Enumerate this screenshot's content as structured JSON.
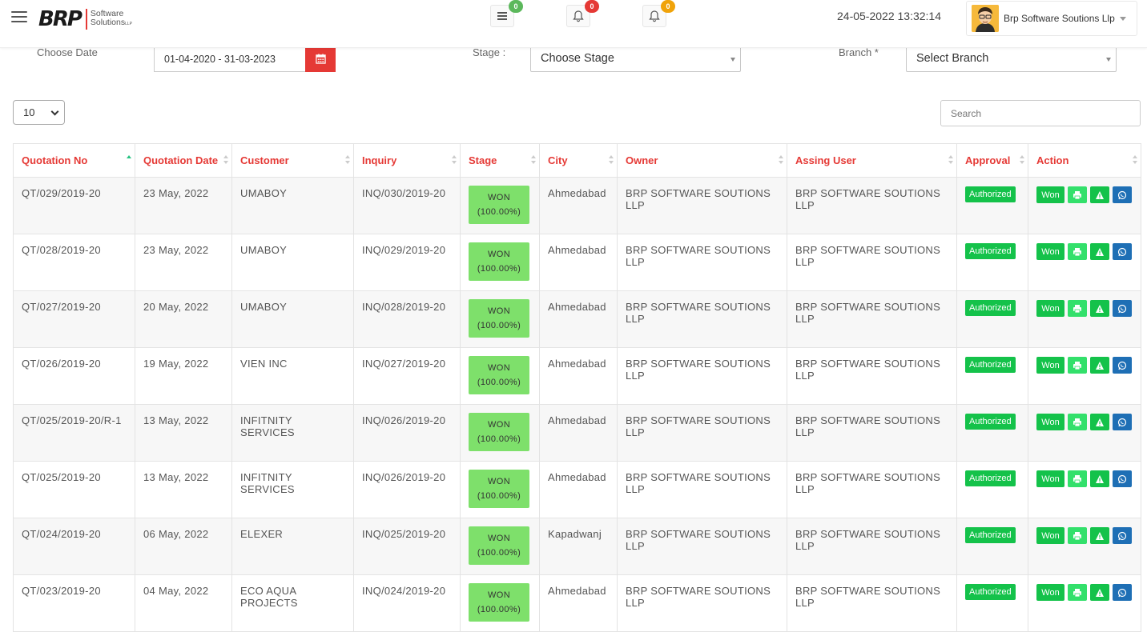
{
  "header": {
    "logo_mark": "BRP",
    "logo_line1": "Software",
    "logo_line2": "Solutions",
    "logo_llp": "LLP",
    "datetime": "24-05-2022 13:32:14",
    "user_name": "Brp Software Soutions Llp",
    "notifications": [
      {
        "name": "list-icon",
        "count": "0",
        "color": "#5cb85c"
      },
      {
        "name": "bell-icon",
        "count": "0",
        "color": "#e53935"
      },
      {
        "name": "bell-icon",
        "count": "0",
        "color": "#f0a30a"
      }
    ]
  },
  "filters": {
    "date_label": "Choose Date",
    "date_value": "01-04-2020 - 31-03-2023",
    "stage_label": "Stage :",
    "stage_value": "Choose Stage",
    "branch_label": "Branch *",
    "branch_value": "Select Branch"
  },
  "table_controls": {
    "page_length": "10",
    "search_placeholder": "Search"
  },
  "table": {
    "columns": [
      "Quotation No",
      "Quotation Date",
      "Customer",
      "Inquiry",
      "Stage",
      "City",
      "Owner",
      "Assing User",
      "Approval",
      "Action"
    ],
    "rows": [
      {
        "no": "QT/029/2019-20",
        "date": "23 May, 2022",
        "customer": "UMABOY",
        "inquiry": "INQ/030/2019-20",
        "stage1": "WON",
        "stage2": "(100.00%)",
        "city": "Ahmedabad",
        "owner": "BRP SOFTWARE SOUTIONS LLP",
        "assign": "BRP SOFTWARE SOUTIONS LLP",
        "approval": "Authorized",
        "action": "Won"
      },
      {
        "no": "QT/028/2019-20",
        "date": "23 May, 2022",
        "customer": "UMABOY",
        "inquiry": "INQ/029/2019-20",
        "stage1": "WON",
        "stage2": "(100.00%)",
        "city": "Ahmedabad",
        "owner": "BRP SOFTWARE SOUTIONS LLP",
        "assign": "BRP SOFTWARE SOUTIONS LLP",
        "approval": "Authorized",
        "action": "Won"
      },
      {
        "no": "QT/027/2019-20",
        "date": "20 May, 2022",
        "customer": "UMABOY",
        "inquiry": "INQ/028/2019-20",
        "stage1": "WON",
        "stage2": "(100.00%)",
        "city": "Ahmedabad",
        "owner": "BRP SOFTWARE SOUTIONS LLP",
        "assign": "BRP SOFTWARE SOUTIONS LLP",
        "approval": "Authorized",
        "action": "Won"
      },
      {
        "no": "QT/026/2019-20",
        "date": "19 May, 2022",
        "customer": "VIEN INC",
        "inquiry": "INQ/027/2019-20",
        "stage1": "WON",
        "stage2": "(100.00%)",
        "city": "Ahmedabad",
        "owner": "BRP SOFTWARE SOUTIONS LLP",
        "assign": "BRP SOFTWARE SOUTIONS LLP",
        "approval": "Authorized",
        "action": "Won"
      },
      {
        "no": "QT/025/2019-20/R-1",
        "date": "13 May, 2022",
        "customer": "INFITNITY SERVICES",
        "inquiry": "INQ/026/2019-20",
        "stage1": "WON",
        "stage2": "(100.00%)",
        "city": "Ahmedabad",
        "owner": "BRP SOFTWARE SOUTIONS LLP",
        "assign": "BRP SOFTWARE SOUTIONS LLP",
        "approval": "Authorized",
        "action": "Won"
      },
      {
        "no": "QT/025/2019-20",
        "date": "13 May, 2022",
        "customer": "INFITNITY SERVICES",
        "inquiry": "INQ/026/2019-20",
        "stage1": "WON",
        "stage2": "(100.00%)",
        "city": "Ahmedabad",
        "owner": "BRP SOFTWARE SOUTIONS LLP",
        "assign": "BRP SOFTWARE SOUTIONS LLP",
        "approval": "Authorized",
        "action": "Won"
      },
      {
        "no": "QT/024/2019-20",
        "date": "06 May, 2022",
        "customer": "ELEXER",
        "inquiry": "INQ/025/2019-20",
        "stage1": "WON",
        "stage2": "(100.00%)",
        "city": "Kapadwanj",
        "owner": "BRP SOFTWARE SOUTIONS LLP",
        "assign": "BRP SOFTWARE SOUTIONS LLP",
        "approval": "Authorized",
        "action": "Won"
      },
      {
        "no": "QT/023/2019-20",
        "date": "04 May, 2022",
        "customer": "ECO AQUA PROJECTS",
        "inquiry": "INQ/024/2019-20",
        "stage1": "WON",
        "stage2": "(100.00%)",
        "city": "Ahmedabad",
        "owner": "BRP SOFTWARE SOUTIONS LLP",
        "assign": "BRP SOFTWARE SOUTIONS LLP",
        "approval": "Authorized",
        "action": "Won"
      }
    ]
  },
  "colors": {
    "accent": "#e53935",
    "stage_won": "#7ee06b",
    "authorized": "#14c24a",
    "whatsapp": "#1e6fb5"
  }
}
